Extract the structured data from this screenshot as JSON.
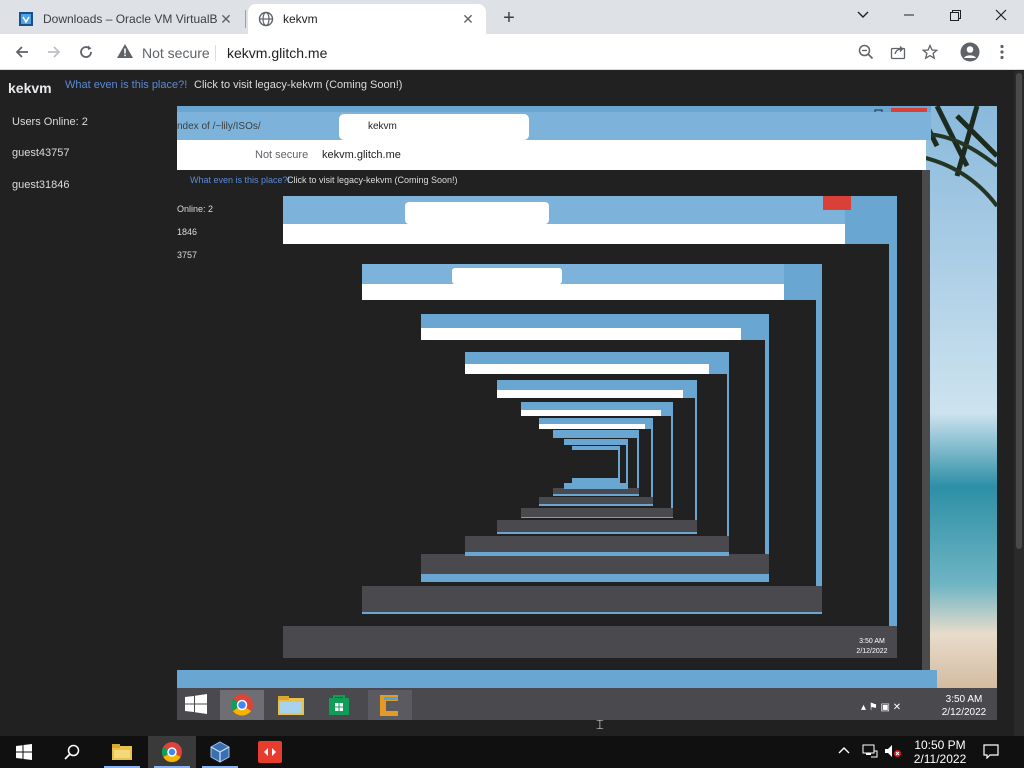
{
  "browser": {
    "tabs": [
      {
        "title": "Downloads – Oracle VM VirtualB",
        "active": false
      },
      {
        "title": "kekvm",
        "active": true
      }
    ],
    "omnibox": {
      "security_label": "Not secure",
      "url": "kekvm.glitch.me"
    }
  },
  "page": {
    "brand": "kekvm",
    "what_link": "What even is this place?!",
    "legacy_text": "Click to visit legacy-kekvm (Coming Soon!)",
    "users_online": "Users Online: 2",
    "users": [
      "guest43757",
      "guest31846"
    ]
  },
  "remote_screen": {
    "tabs": [
      "ndex of /~lily/ISOs/",
      "kekvm"
    ],
    "omnibox": {
      "security_label": "Not secure",
      "url": "kekvm.glitch.me"
    },
    "what_link": "What even is this place?!",
    "legacy_text": "Click to visit legacy-kekvm (Coming Soon!)",
    "users_online": "Online: 2",
    "users": [
      "1846",
      "3757"
    ],
    "clock": {
      "time": "3:50 AM",
      "date": "2/12/2022"
    },
    "inner_clock": {
      "time": "3:50 AM",
      "date": "2/12/2022"
    }
  },
  "taskbar": {
    "clock": {
      "time": "10:50 PM",
      "date": "2/11/2022"
    }
  },
  "colors": {
    "accent": "#8ab4f8",
    "link": "#5b8ad6",
    "remote_titlebar": "#6aa6d2"
  }
}
